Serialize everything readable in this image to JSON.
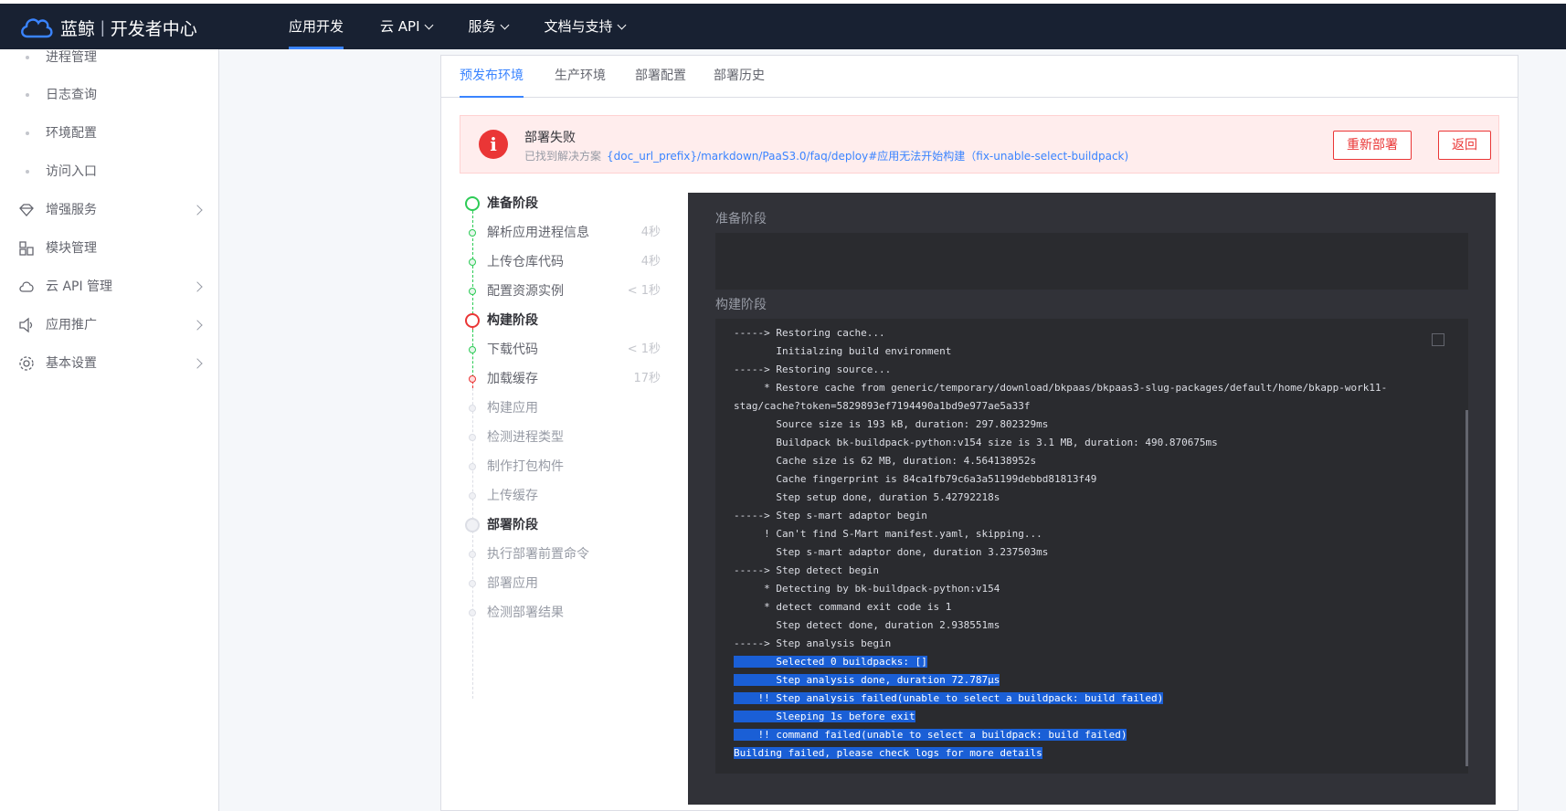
{
  "header": {
    "brand": "蓝鲸",
    "product": "开发者中心",
    "nav": [
      "应用开发",
      "云 API",
      "服务",
      "文档与支持"
    ]
  },
  "sidebar": {
    "sub_items": [
      "进程管理",
      "日志查询",
      "环境配置",
      "访问入口"
    ],
    "items": [
      "增强服务",
      "模块管理",
      "云 API 管理",
      "应用推广",
      "基本设置"
    ]
  },
  "tabs": [
    "预发布环境",
    "生产环境",
    "部署配置",
    "部署历史"
  ],
  "alert": {
    "title": "部署失败",
    "sub_prefix": "已找到解决方案",
    "link": "{doc_url_prefix}/markdown/PaaS3.0/faq/deploy#应用无法开始构建（fix-unable-select-buildpack)",
    "redeploy": "重新部署",
    "back": "返回"
  },
  "steps": {
    "stage1": "准备阶段",
    "stage1_steps": [
      {
        "label": "解析应用进程信息",
        "time": "4秒"
      },
      {
        "label": "上传仓库代码",
        "time": "4秒"
      },
      {
        "label": "配置资源实例",
        "time": "< 1秒"
      }
    ],
    "stage2": "构建阶段",
    "stage2_steps": [
      {
        "label": "下载代码",
        "time": "< 1秒"
      },
      {
        "label": "加载缓存",
        "time": "17秒"
      },
      {
        "label": "构建应用",
        "time": ""
      },
      {
        "label": "检测进程类型",
        "time": ""
      },
      {
        "label": "制作打包构件",
        "time": ""
      },
      {
        "label": "上传缓存",
        "time": ""
      }
    ],
    "stage3": "部署阶段",
    "stage3_steps": [
      {
        "label": "执行部署前置命令",
        "time": ""
      },
      {
        "label": "部署应用",
        "time": ""
      },
      {
        "label": "检测部署结果",
        "time": ""
      }
    ]
  },
  "console": {
    "section1": "准备阶段",
    "section2": "构建阶段",
    "log_lines": [
      "-----> Restoring cache...",
      "       Initialzing build environment",
      "-----> Restoring source...",
      "     * Restore cache from generic/temporary/download/bkpaas/bkpaas3-slug-packages/default/home/bkapp-work11-",
      "stag/cache?token=5829893ef7194490a1bd9e977ae5a33f",
      "       Source size is 193 kB, duration: 297.802329ms",
      "       Buildpack bk-buildpack-python:v154 size is 3.1 MB, duration: 490.870675ms",
      "       Cache size is 62 MB, duration: 4.564138952s",
      "       Cache fingerprint is 84ca1fb79c6a3a51199debbd81813f49",
      "       Step setup done, duration 5.42792218s",
      "-----> Step s-mart adaptor begin",
      "     ! Can't find S-Mart manifest.yaml, skipping...",
      "       Step s-mart adaptor done, duration 3.237503ms",
      "-----> Step detect begin",
      "     * Detecting by bk-buildpack-python:v154",
      "     * detect command exit code is 1",
      "       Step detect done, duration 2.938551ms",
      "-----> Step analysis begin",
      "       Selected 0 buildpacks: []",
      "       Step analysis done, duration 72.787µs",
      "    !! Step analysis failed(unable to select a buildpack: build failed)",
      "       Sleeping 1s before exit",
      "    !! command failed(unable to select a buildpack: build failed)",
      "Building failed, please check logs for more details"
    ],
    "selected_from": 18
  },
  "colors": {
    "primary": "#3a84ff",
    "danger": "#ea3636",
    "success": "#2dcb56",
    "header_bg": "#182132",
    "console_bg": "#313238",
    "selection": "#1a5fd6"
  }
}
